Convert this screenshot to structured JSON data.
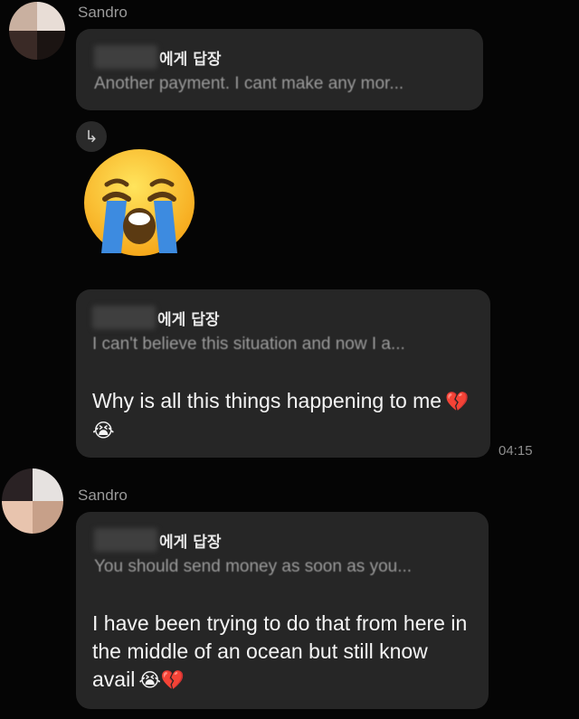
{
  "messages": [
    {
      "sender": "Sandro",
      "reply_label": "에게 답장",
      "reply_quote": "Another payment. I cant make any mor..."
    },
    {
      "big_emoji": "loudly-crying-face"
    },
    {
      "reply_label": "에게 답장",
      "reply_quote": "I can't believe this situation and now I a...",
      "text": "Why is all this things happening to me",
      "emojis": "💔😭",
      "time": "04:15"
    },
    {
      "sender": "Sandro",
      "reply_label": "에게 답장",
      "reply_quote": "You should send money as soon as you...",
      "text": "I have been trying to do that from here in the middle of an ocean but still know avail",
      "emojis": "😭💔"
    }
  ],
  "colors": {
    "background": "#050505",
    "bubble": "#262626",
    "muted_text": "#9a9a9a"
  }
}
